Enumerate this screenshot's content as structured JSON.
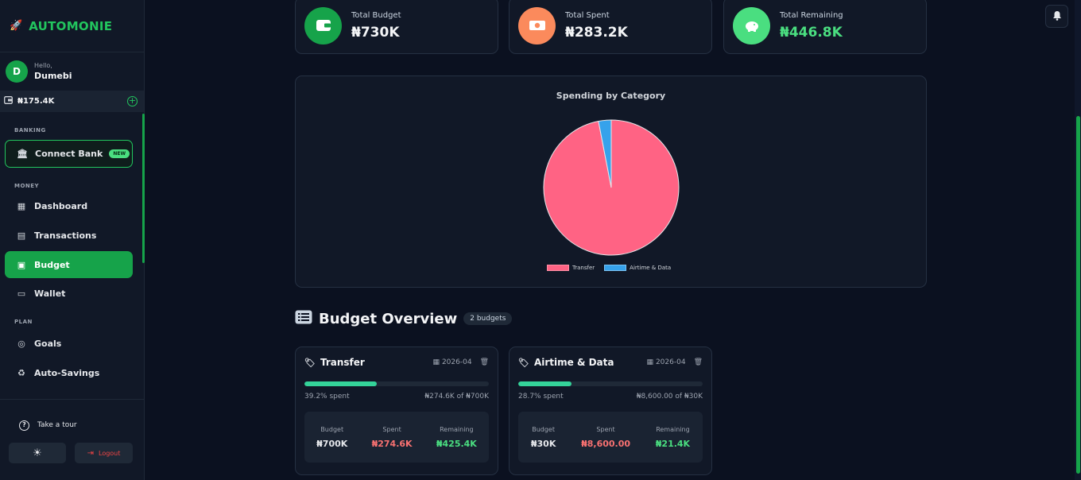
{
  "brand": {
    "name": "AUTOMONIE",
    "icon": "rocket-icon"
  },
  "user": {
    "greeting": "Hello,",
    "name": "Dumebi",
    "initial": "D"
  },
  "wallet": {
    "balance": "₦175.4K"
  },
  "sidebar": {
    "sections": {
      "banking": "BANKING",
      "money": "MONEY",
      "plan": "PLAN"
    },
    "connect_bank": {
      "label": "Connect Bank",
      "badge": "NEW"
    },
    "items": [
      {
        "label": "Dashboard",
        "icon": "dashboard-icon"
      },
      {
        "label": "Transactions",
        "icon": "receipt-icon"
      },
      {
        "label": "Budget",
        "icon": "budget-icon",
        "active": true
      },
      {
        "label": "Wallet",
        "icon": "wallet-icon"
      },
      {
        "label": "Goals",
        "icon": "target-icon"
      },
      {
        "label": "Auto-Savings",
        "icon": "piggy-icon"
      }
    ],
    "tour": "Take a tour",
    "logout": "Logout"
  },
  "stats": [
    {
      "label": "Total Budget",
      "value": "₦730K",
      "color": "#16a34a",
      "icon": "wallet-icon"
    },
    {
      "label": "Total Spent",
      "value": "₦283.2K",
      "color": "#fb923c",
      "icon": "money-icon"
    },
    {
      "label": "Total Remaining",
      "value": "₦446.8K",
      "color": "#4ade80",
      "icon": "piggy-bank-icon"
    }
  ],
  "chart_data": {
    "type": "pie",
    "title": "Spending by Category",
    "categories": [
      "Transfer",
      "Airtime & Data"
    ],
    "values": [
      274.6,
      8.6
    ],
    "colors": [
      "#ff6384",
      "#36a2eb"
    ],
    "legend": "bottom"
  },
  "overview": {
    "title": "Budget Overview",
    "count": "2 budgets"
  },
  "budgets": [
    {
      "name": "Transfer",
      "period": "2026-04",
      "percent": 39.2,
      "percent_label": "39.2% spent",
      "summary": "₦274.6K of ₦700K",
      "budget_label": "Budget",
      "spent_label": "Spent",
      "remaining_label": "Remaining",
      "budget": "₦700K",
      "spent": "₦274.6K",
      "remaining": "₦425.4K"
    },
    {
      "name": "Airtime & Data",
      "period": "2026-04",
      "percent": 28.7,
      "percent_label": "28.7% spent",
      "summary": "₦8,600.00 of ₦30K",
      "budget_label": "Budget",
      "spent_label": "Spent",
      "remaining_label": "Remaining",
      "budget": "₦30K",
      "spent": "₦8,600.00",
      "remaining": "₦21.4K"
    }
  ]
}
